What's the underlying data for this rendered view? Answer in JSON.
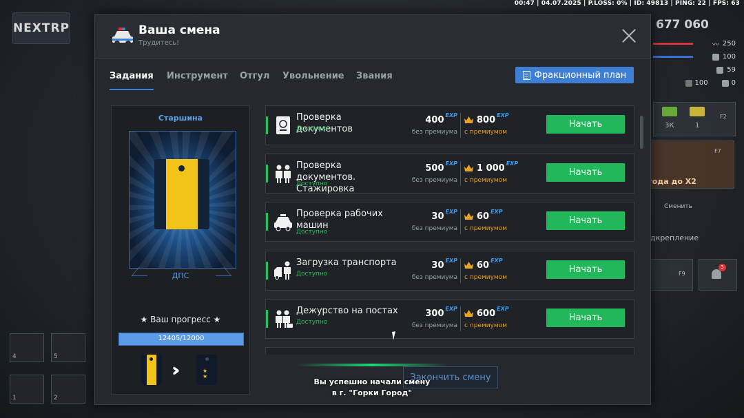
{
  "hud": {
    "topbar": "00:47 | 04.07.2025 | P.LOSS: 0% | ID: 49813 | PING: 22 | FPS: 63",
    "logo_text": "NEXTRP",
    "money": "677 060",
    "stats": [
      {
        "value": "250",
        "icon": "heartbeat-icon",
        "bar_color": "#d9363e"
      },
      {
        "value": "100",
        "icon": "food-icon",
        "bar_color": "#3b6fd6"
      },
      {
        "value": "59",
        "icon": "drink-icon",
        "bar_color": ""
      },
      {
        "value": "100",
        "icon": "armor-icon",
        "extra": "0"
      }
    ],
    "hotbar_counts": {
      "a": "3К",
      "b": "1"
    },
    "key_hints": [
      "F2",
      "F7",
      "F9"
    ],
    "bg_texts": [
      "года до X2",
      "Сменить",
      "дкрепление"
    ],
    "slot_numbers": [
      "4",
      "5",
      "1",
      "2"
    ],
    "notification_count": "3"
  },
  "modal": {
    "title": "Ваша смена",
    "subtitle": "Трудитесь!",
    "tabs": [
      {
        "label": "Задания",
        "active": true
      },
      {
        "label": "Инструмент",
        "active": false
      },
      {
        "label": "Отгул",
        "active": false
      },
      {
        "label": "Увольнение",
        "active": false
      },
      {
        "label": "Звания",
        "active": false
      }
    ],
    "plan_button": "Фракционный план"
  },
  "rank": {
    "title": "Старшина",
    "unit": "ДПС",
    "progress_label": "★ Ваш прогресс ★",
    "progress_text": "12405/12000",
    "progress_fraction": 1.0
  },
  "tasks": [
    {
      "name": "Проверка документов",
      "status": "Доступно",
      "base": "400",
      "premium": "800",
      "base_sub": "без премиума",
      "premium_sub": "с премиумом",
      "button": "Начать",
      "icon": "passport-icon"
    },
    {
      "name": "Проверка документов. Стажировка",
      "status": "Доступно",
      "base": "500",
      "premium": "1 000",
      "base_sub": "без премиума",
      "premium_sub": "с премиумом",
      "button": "Начать",
      "icon": "officers-icon"
    },
    {
      "name": "Проверка рабочих машин",
      "status": "Доступно",
      "base": "30",
      "premium": "60",
      "base_sub": "без премиума",
      "premium_sub": "с премиумом",
      "button": "Начать",
      "icon": "police-car-icon"
    },
    {
      "name": "Загрузка транспорта",
      "status": "Доступно",
      "base": "30",
      "premium": "60",
      "base_sub": "без премиума",
      "premium_sub": "с премиумом",
      "button": "Начать",
      "icon": "loading-icon"
    },
    {
      "name": "Дежурство на постах",
      "status": "Доступно",
      "base": "300",
      "premium": "600",
      "base_sub": "без премиума",
      "premium_sub": "с премиумом",
      "button": "Начать",
      "icon": "patrol-icon"
    }
  ],
  "exp_label": "EXP",
  "end_shift_button": "Закончить смену",
  "toast": {
    "line1": "Вы успешно начали смену",
    "line2": "в г. \"Горки Город\""
  }
}
